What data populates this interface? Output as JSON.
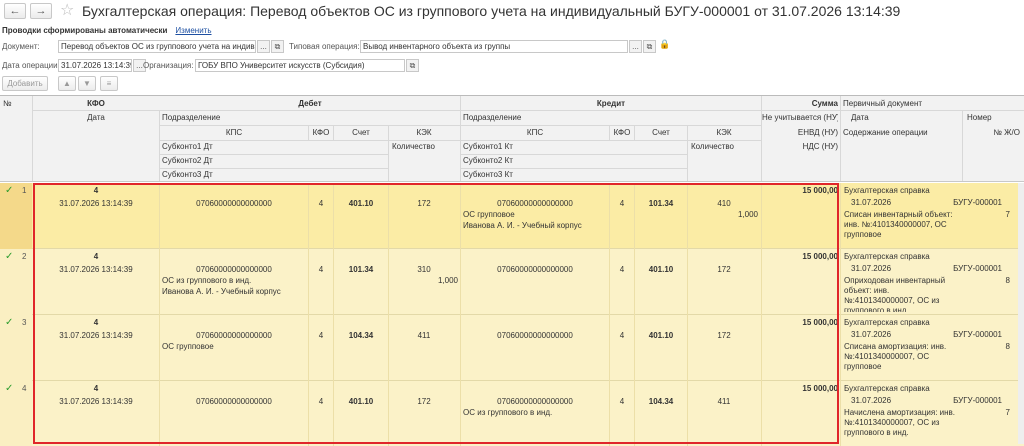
{
  "window": {
    "title": "Бухгалтерская операция: Перевод объектов ОС из группового учета на индивидуальный БУГУ-000001 от 31.07.2026 13:14:39",
    "back_glyph": "←",
    "forward_glyph": "→",
    "star_glyph": "☆"
  },
  "status": {
    "text": "Проводки сформированы автоматически",
    "link": "Изменить"
  },
  "form": {
    "document_label": "Документ:",
    "document_value": "Перевод объектов ОС из группового учета на индивид",
    "typical_label": "Типовая операция:",
    "typical_value": "Вывод инвентарного объекта из группы",
    "date_label": "Дата операции:",
    "date_value": "31.07.2026 13:14:39",
    "org_label": "Организация:",
    "org_value": "ГОБУ ВПО Университет искусств (Субсидия)",
    "more_glyph": "...",
    "open_glyph": "⧉"
  },
  "toolbar": {
    "add_label": "Добавить",
    "up_glyph": "▲",
    "down_glyph": "▼",
    "list_glyph": "≡"
  },
  "columns": {
    "num": "№",
    "kfo": "КФО",
    "date": "Дата",
    "debit": "Дебет",
    "credit": "Кредит",
    "sum": "Сумма",
    "primary_doc": "Первичный документ",
    "division": "Подразделение",
    "kps": "КПС",
    "kfo_short": "КФО",
    "account": "Счет",
    "kek": "КЭК",
    "not_nu": "Не учитывается (НУ)",
    "primary_date": "Дата",
    "primary_number": "Номер",
    "sub1_dt": "Субконто1 Дт",
    "sub2_dt": "Субконто2 Дт",
    "sub3_dt": "Субконто3 Дт",
    "sub1_kt": "Субконто1 Кт",
    "sub2_kt": "Субконто2 Кт",
    "sub3_kt": "Субконто3 Кт",
    "quantity": "Количество",
    "envd": "ЕНВД (НУ)",
    "vat": "НДС (НУ)",
    "content": "Содержание операции",
    "journal_no": "№ Ж/О"
  },
  "rows": [
    {
      "n": "1",
      "check": "✓",
      "kfo": "4",
      "date": "31.07.2026 13:14:39",
      "dt_kps": "07060000000000000",
      "dt_kfo": "4",
      "dt_account": "401.10",
      "dt_kek": "172",
      "dt_sub1": "",
      "dt_sub2": "",
      "dt_qty": "",
      "kt_kps": "07060000000000000",
      "kt_kfo": "4",
      "kt_account": "101.34",
      "kt_kek": "410",
      "kt_sub1": "ОС групповое",
      "kt_sub2": "Иванова А. И. - Учебный корпус",
      "kt_qty": "1,000",
      "sum": "15 000,00",
      "doc_name": "Бухгалтерская справка",
      "doc_date": "31.07.2026",
      "doc_number": "БУГУ-000001",
      "content": "Списан инвентарный объект: инв. №:4101340000007, ОС групповое",
      "journal": "7"
    },
    {
      "n": "2",
      "check": "✓",
      "kfo": "4",
      "date": "31.07.2026 13:14:39",
      "dt_kps": "07060000000000000",
      "dt_kfo": "4",
      "dt_account": "101.34",
      "dt_kek": "310",
      "dt_sub1": "ОС из группового в инд.",
      "dt_sub2": "Иванова А. И. - Учебный корпус",
      "dt_qty": "1,000",
      "kt_kps": "07060000000000000",
      "kt_kfo": "4",
      "kt_account": "401.10",
      "kt_kek": "172",
      "kt_sub1": "",
      "kt_sub2": "",
      "kt_qty": "",
      "sum": "15 000,00",
      "doc_name": "Бухгалтерская справка",
      "doc_date": "31.07.2026",
      "doc_number": "БУГУ-000001",
      "content": "Оприходован инвентарный объект: инв. №:4101340000007, ОС из группового в инд.",
      "journal": "8"
    },
    {
      "n": "3",
      "check": "✓",
      "kfo": "4",
      "date": "31.07.2026 13:14:39",
      "dt_kps": "07060000000000000",
      "dt_kfo": "4",
      "dt_account": "104.34",
      "dt_kek": "411",
      "dt_sub1": "ОС групповое",
      "dt_sub2": "",
      "dt_qty": "",
      "kt_kps": "07060000000000000",
      "kt_kfo": "4",
      "kt_account": "401.10",
      "kt_kek": "172",
      "kt_sub1": "",
      "kt_sub2": "",
      "kt_qty": "",
      "sum": "15 000,00",
      "doc_name": "Бухгалтерская справка",
      "doc_date": "31.07.2026",
      "doc_number": "БУГУ-000001",
      "content": "Списана амортизация: инв. №:4101340000007, ОС групповое",
      "journal": "8"
    },
    {
      "n": "4",
      "check": "✓",
      "kfo": "4",
      "date": "31.07.2026 13:14:39",
      "dt_kps": "07060000000000000",
      "dt_kfo": "4",
      "dt_account": "401.10",
      "dt_kek": "172",
      "dt_sub1": "",
      "dt_sub2": "",
      "dt_qty": "",
      "kt_kps": "07060000000000000",
      "kt_kfo": "4",
      "kt_account": "104.34",
      "kt_kek": "411",
      "kt_sub1": "ОС из группового в инд.",
      "kt_sub2": "",
      "kt_qty": "",
      "sum": "15 000,00",
      "doc_name": "Бухгалтерская справка",
      "doc_date": "31.07.2026",
      "doc_number": "БУГУ-000001",
      "content": "Начислена амортизация: инв. №:4101340000007, ОС из группового в инд.",
      "journal": "7"
    }
  ],
  "colors": {
    "selection": "#fbeca5",
    "row": "#fbf2c8",
    "highlight_box": "#e0262a",
    "link": "#1e50a2",
    "check": "#2e9d2e"
  }
}
